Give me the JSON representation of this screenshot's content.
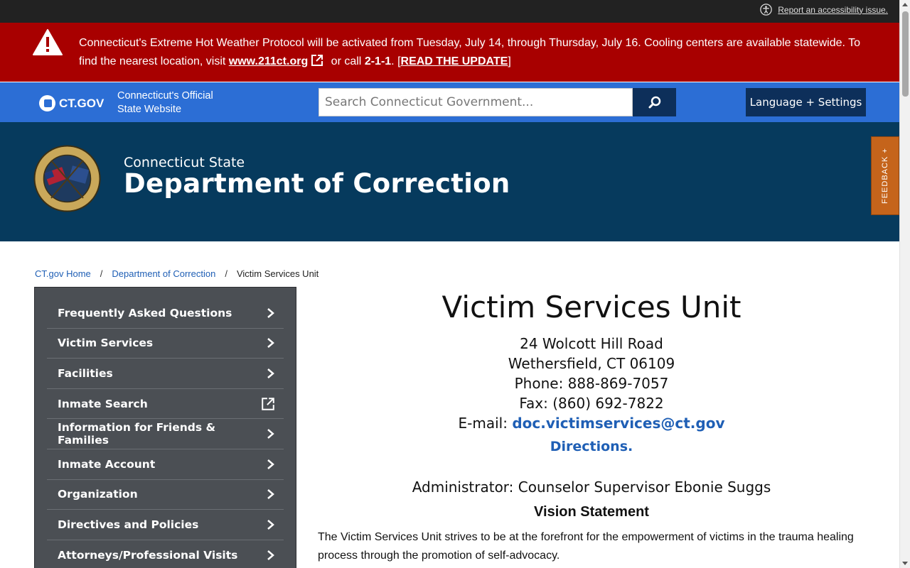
{
  "utility": {
    "accessibility_link": "Report an accessibility issue."
  },
  "alert": {
    "text_before": "Connecticut's Extreme Hot Weather Protocol will be activated from Tuesday, July 14, through Thursday, July 16. Cooling centers are available statewide. To find the nearest location, visit ",
    "link_label": "www.211ct.org",
    "text_middle": " or call ",
    "phone": "2-1-1",
    "text_after": ". [",
    "update_label": "READ THE UPDATE",
    "text_end": "]",
    "bg_color": "#a80000"
  },
  "ctgov": {
    "logo_text": "CT.GOV",
    "tagline_line1": "Connecticut's Official",
    "tagline_line2": "State Website",
    "search_placeholder": "Search Connecticut Government...",
    "language_button": "Language + Settings",
    "bg_color": "#2c6ed5"
  },
  "agency": {
    "pre_title": "Connecticut State",
    "title": "Department of Correction",
    "bg_color": "#063a5d"
  },
  "feedback_tab": "FEEDBACK +",
  "breadcrumb": [
    {
      "label": "CT.gov Home"
    },
    {
      "label": "Department of Correction"
    },
    {
      "label": "Victim Services Unit"
    }
  ],
  "sidenav": {
    "items": [
      {
        "label": "Frequently Asked Questions",
        "icon": "chevron-right-icon"
      },
      {
        "label": "Victim Services",
        "icon": "chevron-right-icon"
      },
      {
        "label": "Facilities",
        "icon": "chevron-right-icon"
      },
      {
        "label": "Inmate Search",
        "icon": "external-link-icon"
      },
      {
        "label": "Information for Friends & Families",
        "icon": "chevron-right-icon"
      },
      {
        "label": "Inmate Account",
        "icon": "chevron-right-icon"
      },
      {
        "label": "Organization",
        "icon": "chevron-right-icon"
      },
      {
        "label": "Directives and Policies",
        "icon": "chevron-right-icon"
      },
      {
        "label": "Attorneys/Professional Visits",
        "icon": "chevron-right-icon"
      }
    ]
  },
  "main": {
    "title": "Victim Services Unit",
    "address_line1": "24 Wolcott Hill Road",
    "address_line2": "Wethersfield, CT 06109",
    "phone": "Phone: 888-869-7057",
    "fax": "Fax: (860) 692-7822",
    "email_label": "E-mail: ",
    "email": "doc.victimservices@ct.gov",
    "directions": "Directions.",
    "administrator": "Administrator: Counselor Supervisor Ebonie Suggs",
    "vision_heading": "Vision Statement",
    "vision_text": "The Victim Services Unit strives to be at the forefront for the empowerment of victims in the trauma healing process through the promotion of self-advocacy."
  }
}
